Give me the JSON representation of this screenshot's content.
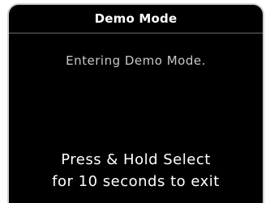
{
  "screen": {
    "title": "Demo Mode",
    "status_message": "Entering Demo Mode.",
    "instruction_line1": "Press & Hold Select",
    "instruction_line2": "for 10 seconds to exit"
  },
  "colors": {
    "background": "#000000",
    "border": "#cfcfcf",
    "title_text": "#ffffff",
    "status_text": "#c8c8c8",
    "instruction_text": "#ffffff"
  }
}
